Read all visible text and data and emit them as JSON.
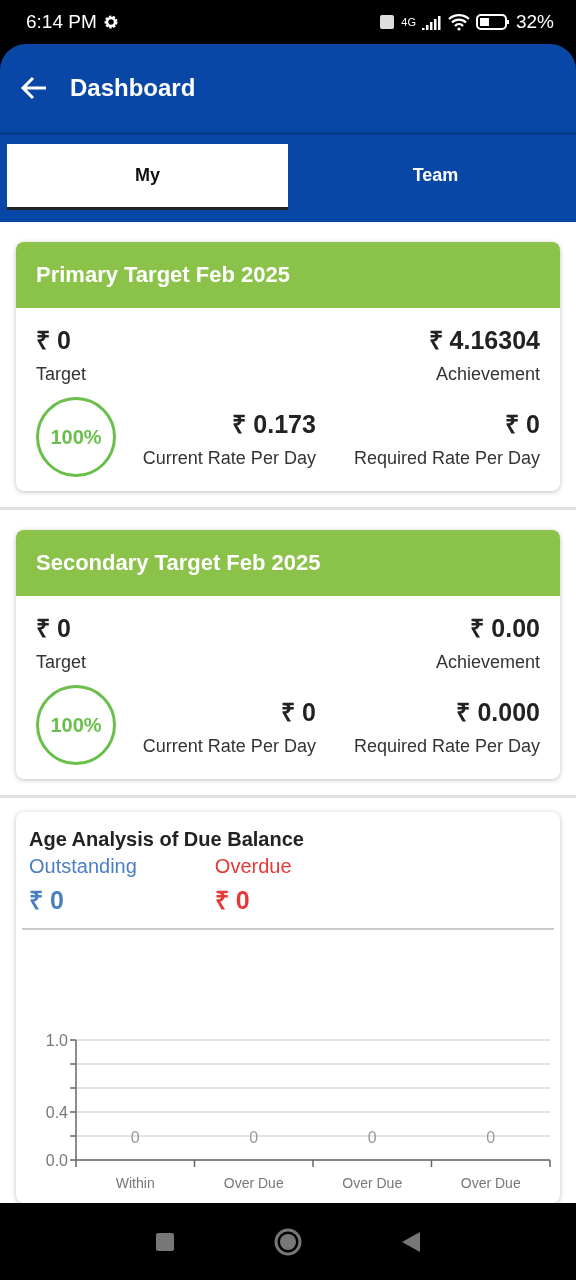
{
  "status_bar": {
    "time": "6:14 PM",
    "network": "4G",
    "battery": "32%"
  },
  "header": {
    "title": "Dashboard"
  },
  "tabs": [
    {
      "label": "My",
      "selected": true
    },
    {
      "label": "Team",
      "selected": false
    }
  ],
  "targets": [
    {
      "title": "Primary Target Feb 2025",
      "target": "₹ 0",
      "target_label": "Target",
      "achievement": "₹ 4.16304",
      "achievement_label": "Achievement",
      "percent": "100%",
      "current_rate": "₹ 0.173",
      "current_rate_label": "Current Rate Per Day",
      "required_rate": "₹ 0",
      "required_rate_label": "Required Rate Per Day"
    },
    {
      "title": "Secondary Target Feb 2025",
      "target": "₹ 0",
      "target_label": "Target",
      "achievement": "₹ 0.00",
      "achievement_label": "Achievement",
      "percent": "100%",
      "current_rate": "₹ 0",
      "current_rate_label": "Current Rate Per Day",
      "required_rate": "₹ 0.000",
      "required_rate_label": "Required Rate Per Day"
    }
  ],
  "age_analysis": {
    "title": "Age Analysis of Due Balance",
    "balances": [
      {
        "label": "Outstanding",
        "amount": "₹ 0",
        "color": "#4a7fc1"
      },
      {
        "label": "Overdue",
        "amount": "₹ 0",
        "color": "#e53935"
      }
    ],
    "chart_data": {
      "type": "bar",
      "categories": [
        "Within",
        "Over Due",
        "Over Due",
        "Over Due"
      ],
      "values": [
        0,
        0,
        0,
        0
      ],
      "ylim": [
        0,
        1
      ],
      "yticks": [
        {
          "value": 0,
          "label": "0.0"
        },
        {
          "value": 0.4,
          "label": "0.4"
        },
        {
          "value": 1,
          "label": "1.0"
        }
      ],
      "data_labels": true
    }
  }
}
